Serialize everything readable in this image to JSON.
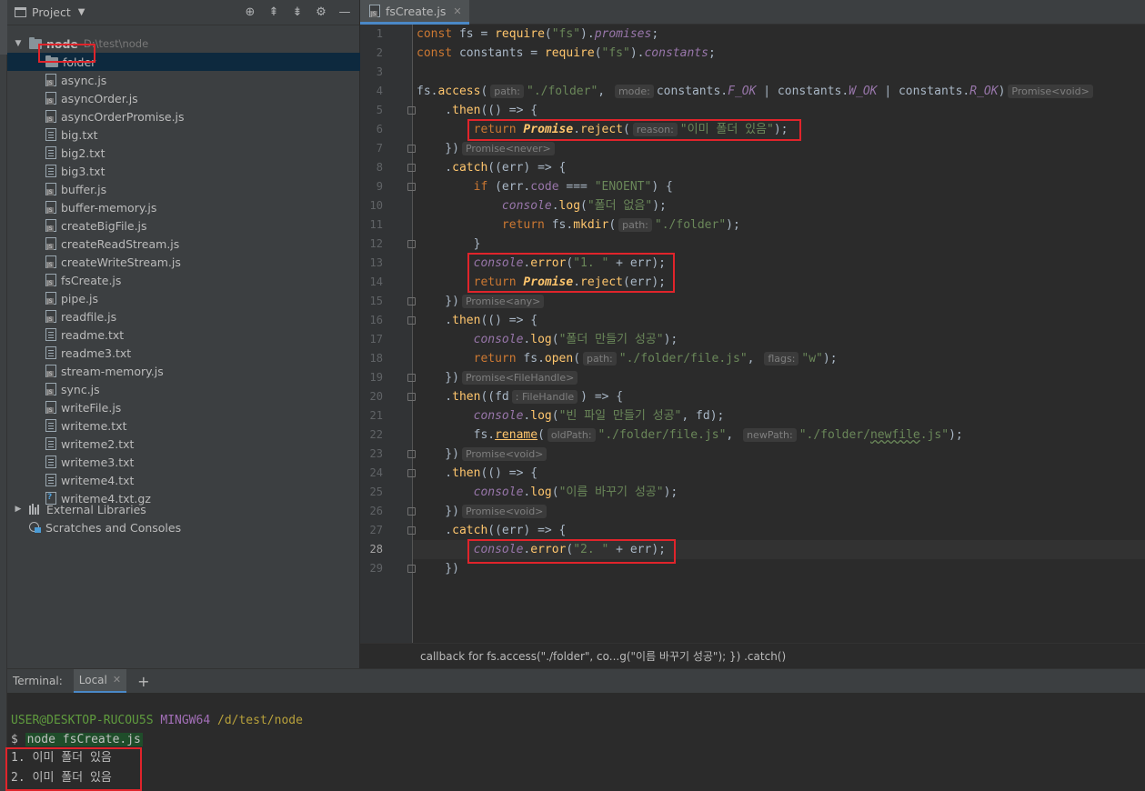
{
  "project": {
    "title": "Project",
    "root": {
      "name": "node",
      "path": "D:\\test\\node"
    },
    "items": [
      {
        "label": "folder",
        "kind": "folder"
      },
      {
        "label": "async.js",
        "kind": "js"
      },
      {
        "label": "asyncOrder.js",
        "kind": "js"
      },
      {
        "label": "asyncOrderPromise.js",
        "kind": "js"
      },
      {
        "label": "big.txt",
        "kind": "txt"
      },
      {
        "label": "big2.txt",
        "kind": "txt"
      },
      {
        "label": "big3.txt",
        "kind": "txt"
      },
      {
        "label": "buffer.js",
        "kind": "js"
      },
      {
        "label": "buffer-memory.js",
        "kind": "js"
      },
      {
        "label": "createBigFile.js",
        "kind": "js"
      },
      {
        "label": "createReadStream.js",
        "kind": "js"
      },
      {
        "label": "createWriteStream.js",
        "kind": "js"
      },
      {
        "label": "fsCreate.js",
        "kind": "js"
      },
      {
        "label": "pipe.js",
        "kind": "js"
      },
      {
        "label": "readfile.js",
        "kind": "js"
      },
      {
        "label": "readme.txt",
        "kind": "txt"
      },
      {
        "label": "readme3.txt",
        "kind": "txt"
      },
      {
        "label": "stream-memory.js",
        "kind": "js"
      },
      {
        "label": "sync.js",
        "kind": "js"
      },
      {
        "label": "writeFile.js",
        "kind": "js"
      },
      {
        "label": "writeme.txt",
        "kind": "txt"
      },
      {
        "label": "writeme2.txt",
        "kind": "txt"
      },
      {
        "label": "writeme3.txt",
        "kind": "txt"
      },
      {
        "label": "writeme4.txt",
        "kind": "txt"
      },
      {
        "label": "writeme4.txt.gz",
        "kind": "gz"
      }
    ],
    "external_libraries": "External Libraries",
    "scratches": "Scratches and Consoles"
  },
  "editor": {
    "tab": "fsCreate.js",
    "breadcrumb": "callback for fs.access(\"./folder\", co...g(\"이름 바꾸기 성공\"); }) .catch()",
    "line_numbers": [
      "1",
      "2",
      "3",
      "4",
      "5",
      "6",
      "7",
      "8",
      "9",
      "10",
      "11",
      "12",
      "13",
      "14",
      "15",
      "16",
      "17",
      "18",
      "19",
      "20",
      "21",
      "22",
      "23",
      "24",
      "25",
      "26",
      "27",
      "28",
      "29"
    ],
    "active_line": 28,
    "hints": {
      "path": "path:",
      "mode": "mode:",
      "reason": "reason:",
      "flags": "flags:",
      "oldPath": "oldPath:",
      "newPath": "newPath:",
      "fh": ": FileHandle",
      "p_void": "Promise<void>",
      "p_never": "Promise<never>",
      "p_any": "Promise<any>",
      "p_fh": "Promise<FileHandle>"
    },
    "strings": {
      "fs": "\"fs\"",
      "folder": "\"./folder\"",
      "exists": "\"이미 폴더 있음\"",
      "enoent": "\"ENOENT\"",
      "nofolder": "\"폴더 없음\"",
      "e1": "\"1. \"",
      "created": "\"폴더 만들기 성공\"",
      "filejs": "\"./folder/file.js\"",
      "w": "\"w\"",
      "emptyfile": "\"빈 파일 만들기 성공\"",
      "newfile_a": "\"./folder/",
      "newfile_b": "newfile",
      "newfile_c": ".js\"",
      "renamed": "\"이름 바꾸기 성공\"",
      "e2": "\"2. \""
    }
  },
  "terminal": {
    "label": "Terminal:",
    "tab": "Local",
    "user": "USER@DESKTOP-RUCOU5S",
    "shell": "MINGW64",
    "cwd": "/d/test/node",
    "prompt": "$",
    "command": "node fsCreate.js",
    "output": [
      "1. 이미 폴더 있음",
      "2. 이미 폴더 있음"
    ]
  }
}
